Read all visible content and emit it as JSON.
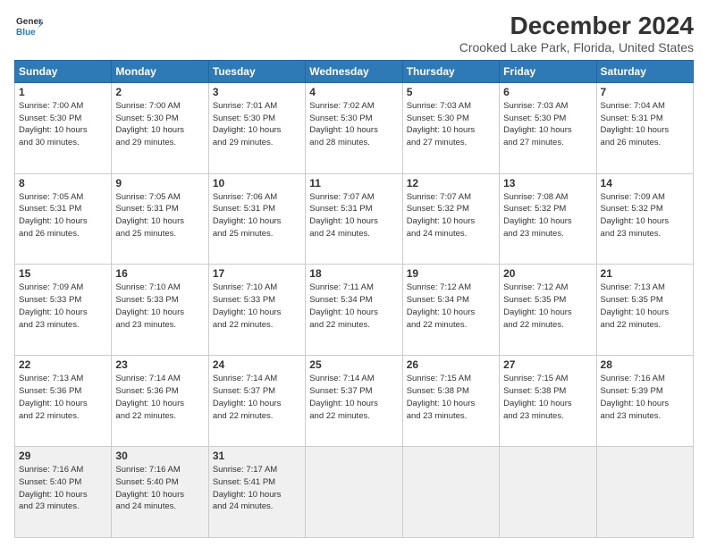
{
  "logo": {
    "line1": "General",
    "line2": "Blue"
  },
  "title": "December 2024",
  "subtitle": "Crooked Lake Park, Florida, United States",
  "headers": [
    "Sunday",
    "Monday",
    "Tuesday",
    "Wednesday",
    "Thursday",
    "Friday",
    "Saturday"
  ],
  "weeks": [
    [
      {
        "day": "1",
        "info": "Sunrise: 7:00 AM\nSunset: 5:30 PM\nDaylight: 10 hours\nand 30 minutes."
      },
      {
        "day": "2",
        "info": "Sunrise: 7:00 AM\nSunset: 5:30 PM\nDaylight: 10 hours\nand 29 minutes."
      },
      {
        "day": "3",
        "info": "Sunrise: 7:01 AM\nSunset: 5:30 PM\nDaylight: 10 hours\nand 29 minutes."
      },
      {
        "day": "4",
        "info": "Sunrise: 7:02 AM\nSunset: 5:30 PM\nDaylight: 10 hours\nand 28 minutes."
      },
      {
        "day": "5",
        "info": "Sunrise: 7:03 AM\nSunset: 5:30 PM\nDaylight: 10 hours\nand 27 minutes."
      },
      {
        "day": "6",
        "info": "Sunrise: 7:03 AM\nSunset: 5:30 PM\nDaylight: 10 hours\nand 27 minutes."
      },
      {
        "day": "7",
        "info": "Sunrise: 7:04 AM\nSunset: 5:31 PM\nDaylight: 10 hours\nand 26 minutes."
      }
    ],
    [
      {
        "day": "8",
        "info": "Sunrise: 7:05 AM\nSunset: 5:31 PM\nDaylight: 10 hours\nand 26 minutes."
      },
      {
        "day": "9",
        "info": "Sunrise: 7:05 AM\nSunset: 5:31 PM\nDaylight: 10 hours\nand 25 minutes."
      },
      {
        "day": "10",
        "info": "Sunrise: 7:06 AM\nSunset: 5:31 PM\nDaylight: 10 hours\nand 25 minutes."
      },
      {
        "day": "11",
        "info": "Sunrise: 7:07 AM\nSunset: 5:31 PM\nDaylight: 10 hours\nand 24 minutes."
      },
      {
        "day": "12",
        "info": "Sunrise: 7:07 AM\nSunset: 5:32 PM\nDaylight: 10 hours\nand 24 minutes."
      },
      {
        "day": "13",
        "info": "Sunrise: 7:08 AM\nSunset: 5:32 PM\nDaylight: 10 hours\nand 23 minutes."
      },
      {
        "day": "14",
        "info": "Sunrise: 7:09 AM\nSunset: 5:32 PM\nDaylight: 10 hours\nand 23 minutes."
      }
    ],
    [
      {
        "day": "15",
        "info": "Sunrise: 7:09 AM\nSunset: 5:33 PM\nDaylight: 10 hours\nand 23 minutes."
      },
      {
        "day": "16",
        "info": "Sunrise: 7:10 AM\nSunset: 5:33 PM\nDaylight: 10 hours\nand 23 minutes."
      },
      {
        "day": "17",
        "info": "Sunrise: 7:10 AM\nSunset: 5:33 PM\nDaylight: 10 hours\nand 22 minutes."
      },
      {
        "day": "18",
        "info": "Sunrise: 7:11 AM\nSunset: 5:34 PM\nDaylight: 10 hours\nand 22 minutes."
      },
      {
        "day": "19",
        "info": "Sunrise: 7:12 AM\nSunset: 5:34 PM\nDaylight: 10 hours\nand 22 minutes."
      },
      {
        "day": "20",
        "info": "Sunrise: 7:12 AM\nSunset: 5:35 PM\nDaylight: 10 hours\nand 22 minutes."
      },
      {
        "day": "21",
        "info": "Sunrise: 7:13 AM\nSunset: 5:35 PM\nDaylight: 10 hours\nand 22 minutes."
      }
    ],
    [
      {
        "day": "22",
        "info": "Sunrise: 7:13 AM\nSunset: 5:36 PM\nDaylight: 10 hours\nand 22 minutes."
      },
      {
        "day": "23",
        "info": "Sunrise: 7:14 AM\nSunset: 5:36 PM\nDaylight: 10 hours\nand 22 minutes."
      },
      {
        "day": "24",
        "info": "Sunrise: 7:14 AM\nSunset: 5:37 PM\nDaylight: 10 hours\nand 22 minutes."
      },
      {
        "day": "25",
        "info": "Sunrise: 7:14 AM\nSunset: 5:37 PM\nDaylight: 10 hours\nand 22 minutes."
      },
      {
        "day": "26",
        "info": "Sunrise: 7:15 AM\nSunset: 5:38 PM\nDaylight: 10 hours\nand 23 minutes."
      },
      {
        "day": "27",
        "info": "Sunrise: 7:15 AM\nSunset: 5:38 PM\nDaylight: 10 hours\nand 23 minutes."
      },
      {
        "day": "28",
        "info": "Sunrise: 7:16 AM\nSunset: 5:39 PM\nDaylight: 10 hours\nand 23 minutes."
      }
    ],
    [
      {
        "day": "29",
        "info": "Sunrise: 7:16 AM\nSunset: 5:40 PM\nDaylight: 10 hours\nand 23 minutes."
      },
      {
        "day": "30",
        "info": "Sunrise: 7:16 AM\nSunset: 5:40 PM\nDaylight: 10 hours\nand 24 minutes."
      },
      {
        "day": "31",
        "info": "Sunrise: 7:17 AM\nSunset: 5:41 PM\nDaylight: 10 hours\nand 24 minutes."
      },
      {
        "day": "",
        "info": ""
      },
      {
        "day": "",
        "info": ""
      },
      {
        "day": "",
        "info": ""
      },
      {
        "day": "",
        "info": ""
      }
    ]
  ]
}
